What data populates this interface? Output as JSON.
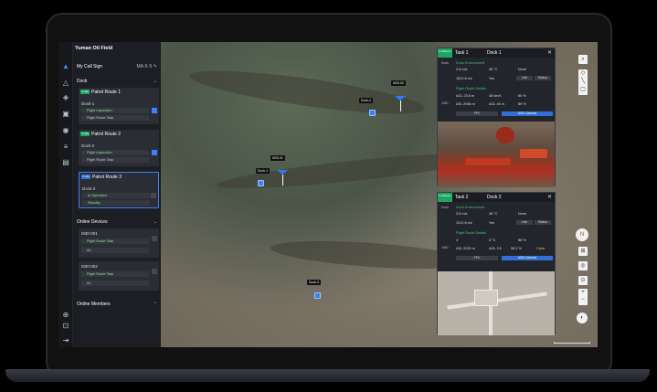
{
  "app": {
    "title": "Yuman Oil Field"
  },
  "sidebar": {
    "call_sign_label": "My Call Sign",
    "call_sign_value": "MA-5-S ✎",
    "dock_section": "Dock",
    "docks": [
      {
        "badge": "In idle",
        "route": "Patrol Route 1",
        "dock": "Dock-1",
        "line1": "Flight Inspection",
        "line2": "Flight Route Task"
      },
      {
        "badge": "In idle",
        "route": "Patrol Route 2",
        "dock": "Dock-2",
        "line1": "Flight Inspection",
        "line2": "Flight Route Task"
      },
      {
        "badge": "In idle",
        "route": "Patrol Route 3",
        "dock": "Dock-3",
        "line1": "In Operation",
        "line2": "Standby"
      }
    ],
    "online_devices_section": "Online Devices",
    "devices": [
      {
        "name": "M30-001",
        "line1": "Flight Route Task",
        "line2": "A1"
      },
      {
        "name": "M30-002",
        "line1": "Flight Route Task",
        "line2": "A1"
      }
    ],
    "online_members_section": "Online Members"
  },
  "map": {
    "dock_labels": [
      "Dock-1",
      "Dock-2",
      "Dock-3"
    ],
    "drone_labels": [
      "M30-01",
      "M30-02"
    ]
  },
  "tasks": [
    {
      "status": "In Mission",
      "title": "Task 1",
      "dock": "Dock 1",
      "side_top": "Dock",
      "side_bottom": "M30",
      "sec1": "Dock Environment",
      "r1": [
        "2.8 m/s",
        "28 °C",
        "None"
      ],
      "r2": [
        "1522.8 s/s",
        "Yes",
        "Live",
        "Status"
      ],
      "sec2": "Flight Route Details",
      "r3": [
        "AGL 23.6 m",
        "48 km/h",
        "80 %"
      ],
      "r4": [
        "ASL 2066 m",
        "AGL 45 m",
        "89 %"
      ],
      "buttons": [
        "FPV",
        "M30 Camera"
      ]
    },
    {
      "status": "In Mission",
      "title": "Task 2",
      "dock": "Dock 2",
      "side_top": "Dock",
      "side_bottom": "M30",
      "sec1": "Dock Environment",
      "r1": [
        "3.5 m/s",
        "28 °C",
        "None"
      ],
      "r2": [
        "1012.8 s/s",
        "Yes",
        "Live",
        "Status"
      ],
      "sec2": "Flight Route Details",
      "r3": [
        "4",
        "8 °C",
        "88 %"
      ],
      "r4": [
        "ASL 2033 m",
        "AGL 3.5",
        "98.2 %",
        "Clear"
      ],
      "buttons": [
        "FPV",
        "M30 Camera"
      ]
    }
  ],
  "colors": {
    "accent": "#3b82f6",
    "status_green": "#1fa463",
    "panel": "#22252b"
  }
}
